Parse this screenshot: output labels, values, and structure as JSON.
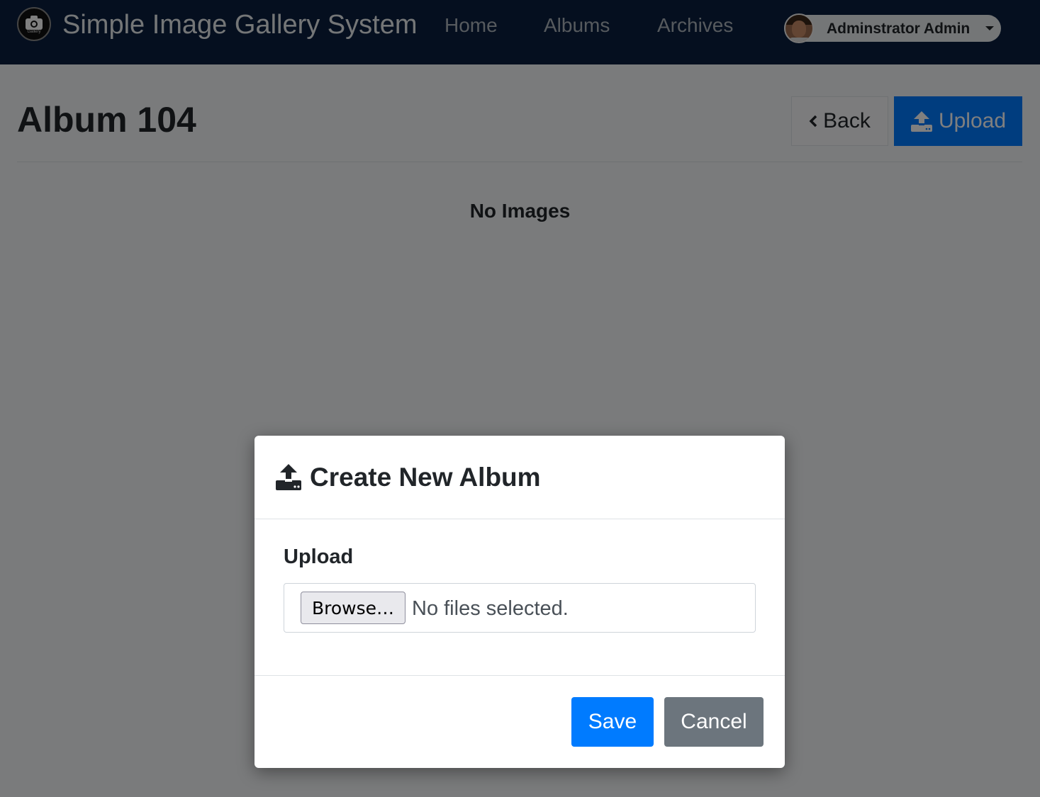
{
  "navbar": {
    "logo_text": "Gallery",
    "brand": "Simple Image Gallery System",
    "links": {
      "home": "Home",
      "albums": "Albums",
      "archives": "Archives"
    },
    "user_name": "Adminstrator Admin"
  },
  "page": {
    "title": "Album 104",
    "back_label": "Back",
    "upload_label": "Upload",
    "empty_message": "No Images"
  },
  "modal": {
    "title": "Create New Album",
    "field_label": "Upload",
    "browse_label": "Browse…",
    "file_status": "No files selected.",
    "save_label": "Save",
    "cancel_label": "Cancel"
  },
  "colors": {
    "navbar_bg": "#0b1f3f",
    "primary": "#007bff",
    "secondary": "#6c757d"
  }
}
